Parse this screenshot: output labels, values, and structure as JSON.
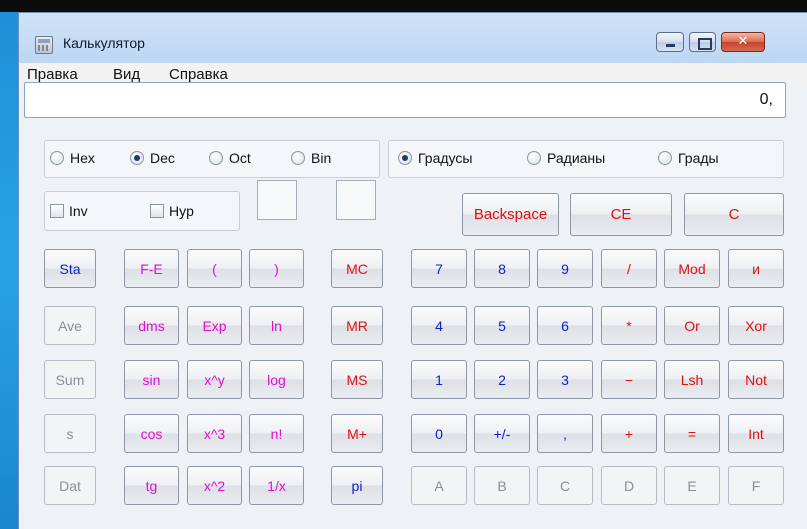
{
  "window": {
    "title": "Калькулятор",
    "close_glyph": "✕"
  },
  "menu": [
    "Правка",
    "Вид",
    "Справка"
  ],
  "display": {
    "value": "0,"
  },
  "base_options": [
    {
      "label": "Hex",
      "selected": false
    },
    {
      "label": "Dec",
      "selected": true
    },
    {
      "label": "Oct",
      "selected": false
    },
    {
      "label": "Bin",
      "selected": false
    }
  ],
  "angle_options": [
    {
      "label": "Градусы",
      "selected": true
    },
    {
      "label": "Радианы",
      "selected": false
    },
    {
      "label": "Грады",
      "selected": false
    }
  ],
  "checkboxes": [
    {
      "label": "Inv",
      "checked": false
    },
    {
      "label": "Hyp",
      "checked": false
    }
  ],
  "top_buttons": [
    {
      "label": "Backspace",
      "color": "red"
    },
    {
      "label": "CE",
      "color": "red"
    },
    {
      "label": "C",
      "color": "red"
    }
  ],
  "stat_buttons": [
    {
      "label": "Sta",
      "color": "blue",
      "enabled": true
    },
    {
      "label": "Ave",
      "color": "gray",
      "enabled": false
    },
    {
      "label": "Sum",
      "color": "gray",
      "enabled": false
    },
    {
      "label": "s",
      "color": "gray",
      "enabled": false
    },
    {
      "label": "Dat",
      "color": "gray",
      "enabled": false
    }
  ],
  "func_rows": [
    [
      {
        "label": "F-E"
      },
      {
        "label": "("
      },
      {
        "label": ")"
      }
    ],
    [
      {
        "label": "dms"
      },
      {
        "label": "Exp"
      },
      {
        "label": "ln"
      }
    ],
    [
      {
        "label": "sin"
      },
      {
        "label": "x^y"
      },
      {
        "label": "log"
      }
    ],
    [
      {
        "label": "cos"
      },
      {
        "label": "x^3"
      },
      {
        "label": "n!"
      }
    ],
    [
      {
        "label": "tg"
      },
      {
        "label": "x^2"
      },
      {
        "label": "1/x"
      }
    ]
  ],
  "memory_buttons": [
    {
      "label": "MC",
      "color": "red"
    },
    {
      "label": "MR",
      "color": "red"
    },
    {
      "label": "MS",
      "color": "red"
    },
    {
      "label": "M+",
      "color": "red"
    },
    {
      "label": "pi",
      "color": "blue"
    }
  ],
  "num_rows": [
    [
      {
        "label": "7",
        "color": "blue"
      },
      {
        "label": "8",
        "color": "blue"
      },
      {
        "label": "9",
        "color": "blue"
      },
      {
        "label": "/",
        "color": "red"
      },
      {
        "label": "Mod",
        "color": "red"
      },
      {
        "label": "и",
        "color": "red"
      }
    ],
    [
      {
        "label": "4",
        "color": "blue"
      },
      {
        "label": "5",
        "color": "blue"
      },
      {
        "label": "6",
        "color": "blue"
      },
      {
        "label": "*",
        "color": "red"
      },
      {
        "label": "Or",
        "color": "red"
      },
      {
        "label": "Xor",
        "color": "red"
      }
    ],
    [
      {
        "label": "1",
        "color": "blue"
      },
      {
        "label": "2",
        "color": "blue"
      },
      {
        "label": "3",
        "color": "blue"
      },
      {
        "label": "−",
        "color": "red"
      },
      {
        "label": "Lsh",
        "color": "red"
      },
      {
        "label": "Not",
        "color": "red"
      }
    ],
    [
      {
        "label": "0",
        "color": "blue"
      },
      {
        "label": "+/-",
        "color": "blue"
      },
      {
        "label": ",",
        "color": "blue"
      },
      {
        "label": "+",
        "color": "red"
      },
      {
        "label": "=",
        "color": "red"
      },
      {
        "label": "Int",
        "color": "red"
      }
    ],
    [
      {
        "label": "A",
        "color": "gray",
        "enabled": false
      },
      {
        "label": "B",
        "color": "gray",
        "enabled": false
      },
      {
        "label": "C",
        "color": "gray",
        "enabled": false
      },
      {
        "label": "D",
        "color": "gray",
        "enabled": false
      },
      {
        "label": "E",
        "color": "gray",
        "enabled": false
      },
      {
        "label": "F",
        "color": "gray",
        "enabled": false
      }
    ]
  ]
}
